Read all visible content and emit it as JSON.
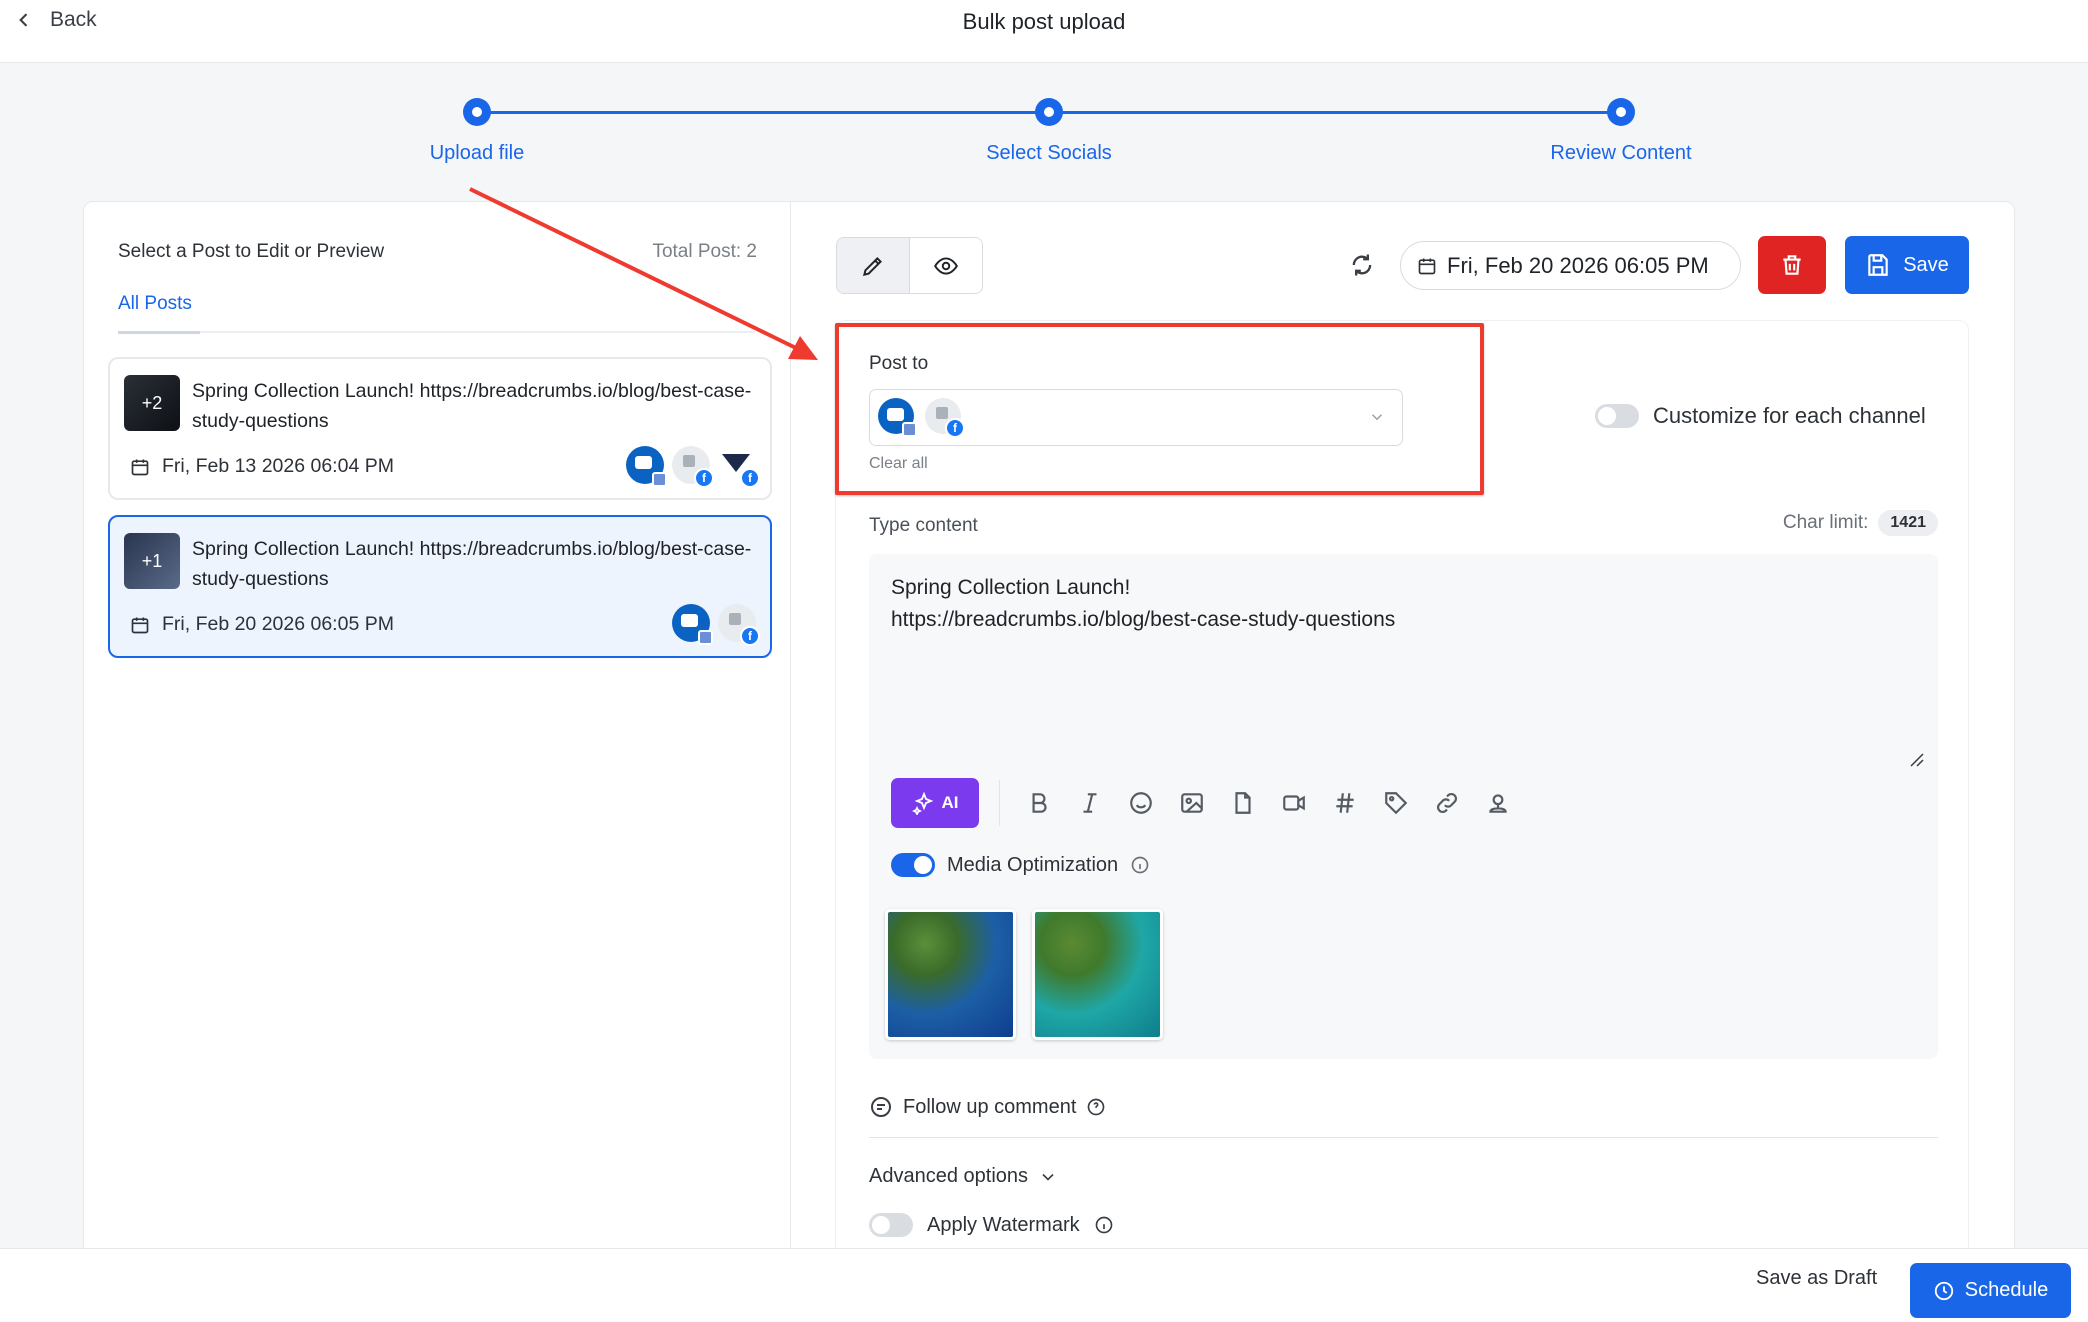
{
  "header": {
    "back_label": "Back",
    "title": "Bulk post upload"
  },
  "stepper": {
    "steps": [
      {
        "label": "Upload file"
      },
      {
        "label": "Select Socials"
      },
      {
        "label": "Review Content"
      }
    ]
  },
  "left_panel": {
    "title": "Select a Post to Edit or Preview",
    "total": "Total Post: 2",
    "tab": "All Posts",
    "posts": [
      {
        "badge": "+2",
        "text": "Spring Collection Launch! https://breadcrumbs.io/blog/best-case-study-questions",
        "date": "Fri, Feb 13 2026 06:04 PM"
      },
      {
        "badge": "+1",
        "text": "Spring Collection Launch! https://breadcrumbs.io/blog/best-case-study-questions",
        "date": "Fri, Feb 20 2026 06:05 PM"
      }
    ]
  },
  "editor": {
    "date": "Fri, Feb 20 2026 06:05 PM",
    "save_label": "Save",
    "post_to_label": "Post to",
    "clear_all": "Clear all",
    "customize_label": "Customize for each channel",
    "type_label": "Type content",
    "char_limit_label": "Char limit:",
    "char_limit_value": "1421",
    "content": "Spring Collection Launch!\nhttps://breadcrumbs.io/blog/best-case-study-questions",
    "ai_label": "AI",
    "media_opt_label": "Media Optimization",
    "follow_up_label": "Follow up comment",
    "advanced_label": "Advanced options",
    "watermark_label": "Apply Watermark"
  },
  "footer": {
    "draft_label": "Save as Draft",
    "schedule_label": "Schedule"
  },
  "colors": {
    "accent": "#1a66e8",
    "danger": "#e02424",
    "ai": "#7b3aed",
    "annotation": "#ef3a2f"
  }
}
